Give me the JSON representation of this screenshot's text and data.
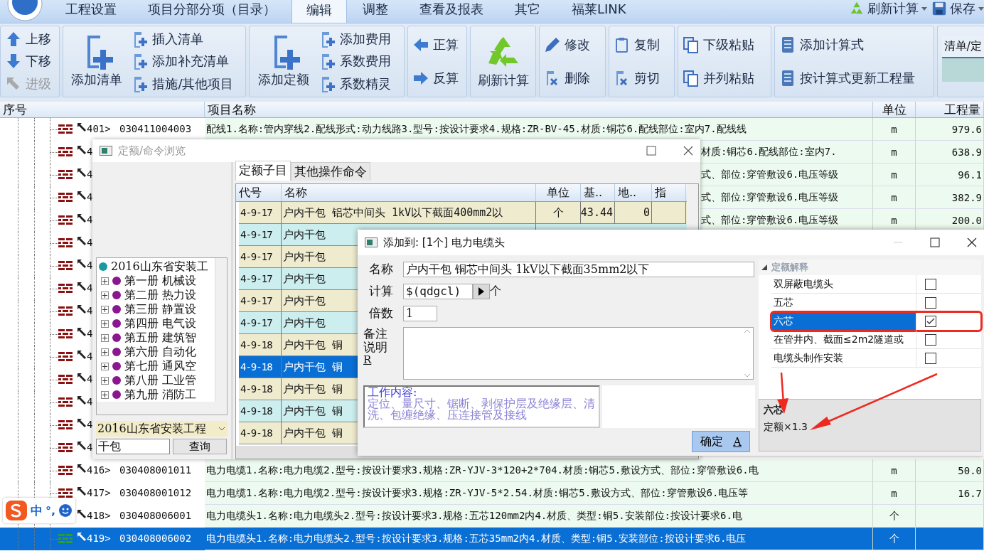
{
  "menu_tabs": [
    {
      "label": "工程设置",
      "selected": false
    },
    {
      "label": "项目分部分项（目录）",
      "selected": false
    },
    {
      "label": "编辑",
      "selected": true
    },
    {
      "label": "调整",
      "selected": false
    },
    {
      "label": "查看及报表",
      "selected": false
    },
    {
      "label": "其它",
      "selected": false
    },
    {
      "label": "福莱LINK",
      "selected": false
    }
  ],
  "quick_actions": [
    {
      "label": "刷新计算"
    },
    {
      "label": "保存"
    }
  ],
  "ribbon": [
    {
      "items": [
        {
          "label": "上移",
          "kind": "small",
          "disabled": false
        },
        {
          "label": "下移",
          "kind": "small",
          "disabled": false
        },
        {
          "label": "进级",
          "kind": "small",
          "disabled": true
        }
      ]
    },
    {
      "items": [
        {
          "label": "添加清单",
          "kind": "large",
          "disabled": false
        },
        {
          "label": "插入清单",
          "kind": "small",
          "disabled": false
        },
        {
          "label": "添加补充清单",
          "kind": "small",
          "disabled": false
        },
        {
          "label": "措施/其他项目",
          "kind": "small",
          "disabled": false
        }
      ]
    },
    {
      "items": [
        {
          "label": "添加定额",
          "kind": "large",
          "disabled": false
        },
        {
          "label": "添加费用",
          "kind": "small",
          "disabled": false
        },
        {
          "label": "系数费用",
          "kind": "small",
          "disabled": false
        },
        {
          "label": "系数精灵",
          "kind": "small",
          "disabled": false
        }
      ]
    },
    {
      "items": [
        {
          "label": "正算",
          "kind": "small",
          "disabled": false
        },
        {
          "label": "反算",
          "kind": "small",
          "disabled": false
        }
      ]
    },
    {
      "items": [
        {
          "label": "刷新计算",
          "kind": "large",
          "disabled": false
        }
      ]
    },
    {
      "items": [
        {
          "label": "修改",
          "kind": "small",
          "disabled": false
        },
        {
          "label": "删除",
          "kind": "small",
          "disabled": false
        }
      ]
    },
    {
      "items": [
        {
          "label": "复制",
          "kind": "small",
          "disabled": false
        },
        {
          "label": "剪切",
          "kind": "small",
          "disabled": false
        }
      ]
    },
    {
      "items": [
        {
          "label": "下级粘贴",
          "kind": "small",
          "disabled": false
        },
        {
          "label": "并列粘贴",
          "kind": "small",
          "disabled": false
        }
      ]
    },
    {
      "items": [
        {
          "label": "添加计算式",
          "kind": "small",
          "disabled": false
        },
        {
          "label": "按计算式更新工程量",
          "kind": "small",
          "disabled": false
        }
      ]
    }
  ],
  "ribbon_panel": {
    "header": "清单/定"
  },
  "table": {
    "columns": [
      "序号",
      "项目名称",
      "单位",
      "工程量"
    ],
    "rows": [
      {
        "kind": "full",
        "seq": "401>",
        "code": "030411004003",
        "name": "配线1.名称:管内穿线2.配线形式:动力线路3.型号:按设计要求4.规格:ZR-BV-45.材质:铜芯6.配线部位:室内7.配线线",
        "unit": "m",
        "qty": "979.6",
        "selected": false
      },
      {
        "kind": "tail",
        "seq": "4",
        "name": "材质:铜芯6.配线部位:室内7.",
        "unit": "m",
        "qty": "638.9",
        "selected": false
      },
      {
        "kind": "tail",
        "seq": "4",
        "name": "式、部位:穿管敷设6.电压等级",
        "unit": "m",
        "qty": "96.1",
        "selected": false
      },
      {
        "kind": "tail",
        "seq": "4",
        "name": "式、部位:穿管敷设6.电压等级",
        "unit": "m",
        "qty": "382.9",
        "selected": false
      },
      {
        "kind": "tail",
        "seq": "4",
        "name": "式、部位:穿管敷设6.电压等级",
        "unit": "m",
        "qty": "200.0",
        "selected": false
      },
      {
        "kind": "covered",
        "seq": "4",
        "selected": false
      },
      {
        "kind": "covered",
        "seq": "4",
        "selected": false
      },
      {
        "kind": "covered",
        "seq": "4",
        "selected": false
      },
      {
        "kind": "covered",
        "seq": "4",
        "selected": false
      },
      {
        "kind": "covered",
        "seq": "4",
        "selected": false
      },
      {
        "kind": "covered",
        "seq": "4",
        "selected": false
      },
      {
        "kind": "covered",
        "seq": "4",
        "selected": false
      },
      {
        "kind": "covered",
        "seq": "4",
        "selected": false
      },
      {
        "kind": "covered",
        "seq": "4",
        "selected": false
      },
      {
        "kind": "covered",
        "seq": "4",
        "selected": false
      },
      {
        "kind": "full",
        "seq": "416>",
        "code": "030408001011",
        "name": "电力电缆1.名称:电力电缆2.型号:按设计要求3.规格:ZR-YJV-3*120+2*704.材质:铜芯5.敷设方式、部位:穿管敷设6.电",
        "unit": "m",
        "qty": "50.0",
        "selected": false
      },
      {
        "kind": "full",
        "seq": "417>",
        "code": "030408001012",
        "name": "电力电缆1.名称:电力电缆2.型号:按设计要求3.规格:ZR-YJV-5*2.54.材质:铜芯5.敷设方式、部位:穿管敷设6.电压等",
        "unit": "m",
        "qty": "16.7",
        "selected": false
      },
      {
        "kind": "full",
        "seq": "418>",
        "code": "030408006001",
        "name": "电力电缆头1.名称:电力电缆头2.型号:按设计要求3.规格:五芯120mm2内4.材质、类型:铜5.安装部位:按设计要求6.电",
        "unit": "个",
        "selected": false
      },
      {
        "kind": "full",
        "seq": "419>",
        "code": "030408006002",
        "name": "电力电缆头1.名称:电力电缆头2.型号:按设计要求3.规格:五芯35mm2内4.材质、类型:铜5.安装部位:按设计要求6.电压",
        "unit": "个",
        "selected": true
      }
    ]
  },
  "browse_dialog": {
    "title": "定额/命令浏览",
    "tree": {
      "root": "2016山东省安装工",
      "children": [
        {
          "label": "第一册 机械设",
          "expanded": false
        },
        {
          "label": "第二册 热力设",
          "expanded": false
        },
        {
          "label": "第三册 静置设",
          "expanded": false
        },
        {
          "label": "第四册 电气设",
          "expanded": false
        },
        {
          "label": "第五册 建筑智",
          "expanded": false
        },
        {
          "label": "第六册 自动化",
          "expanded": false
        },
        {
          "label": "第七册 通风空",
          "expanded": false
        },
        {
          "label": "第八册 工业管",
          "expanded": false
        },
        {
          "label": "第九册 消防工",
          "expanded": false
        }
      ]
    },
    "library": "2016山东省安装工程",
    "search_value": "干包",
    "search_button": "查询",
    "tabs": [
      {
        "label": "定额子目",
        "selected": true
      },
      {
        "label": "其他操作命令",
        "selected": false
      }
    ],
    "columns": [
      "代号",
      "名称",
      "单位",
      "基..",
      "地..",
      "指"
    ],
    "rows": [
      {
        "code": "4-9-17",
        "name": "户内干包 铝芯中间头 1kV以下截面400mm2以",
        "unit": "个",
        "base": "43.44",
        "local": "0",
        "selected": false
      },
      {
        "code": "4-9-17",
        "name": "户内干包",
        "selected": false
      },
      {
        "code": "4-9-17",
        "name": "户内干包",
        "selected": false
      },
      {
        "code": "4-9-17",
        "name": "户内干包",
        "selected": false
      },
      {
        "code": "4-9-17",
        "name": "户内干包",
        "selected": false
      },
      {
        "code": "4-9-17",
        "name": "户内干包",
        "selected": false
      },
      {
        "code": "4-9-18",
        "name": "户内干包 铜",
        "selected": false
      },
      {
        "code": "4-9-18",
        "name": "户内干包 铜",
        "selected": true
      },
      {
        "code": "4-9-18",
        "name": "户内干包 铜",
        "selected": false
      },
      {
        "code": "4-9-18",
        "name": "户内干包 铜",
        "selected": false
      },
      {
        "code": "4-9-18",
        "name": "户内干包 铜",
        "selected": false
      }
    ]
  },
  "add_dialog": {
    "title": "添加到: [1个] 电力电缆头",
    "name_label": "名称",
    "name_value": "户内干包 铜芯中间头  1kV以下截面35mm2以下",
    "calc_label": "计算",
    "calc_value": "$(qdgcl)",
    "calc_unit": "个",
    "factor_label": "倍数",
    "factor_value": "1",
    "note_label": "备注说明",
    "note_hotkey": "R",
    "work_title": "工作内容:",
    "work_text": "定位、量尺寸、锯断、剥保护层及绝缘层、清洗、包缠绝缘、压连接管及接线",
    "ok_button": "确定",
    "ok_hotkey": "A",
    "section": "定额解释",
    "options": [
      {
        "label": "双屏蔽电缆头",
        "checked": false,
        "selected": false,
        "annotated": false
      },
      {
        "label": "五芯",
        "checked": false,
        "selected": false,
        "annotated": false
      },
      {
        "label": "六芯",
        "checked": true,
        "selected": true,
        "annotated": true
      },
      {
        "label": "在管井内、截面≤2m2隧道或",
        "checked": false,
        "selected": false,
        "annotated": false
      },
      {
        "label": "电缆头制作安装",
        "checked": false,
        "selected": false,
        "annotated": false
      }
    ],
    "description_title": "六芯",
    "description_text": "定额×1.3"
  },
  "ime_toolbar": {
    "mode": "中",
    "punctuation": "°,"
  }
}
